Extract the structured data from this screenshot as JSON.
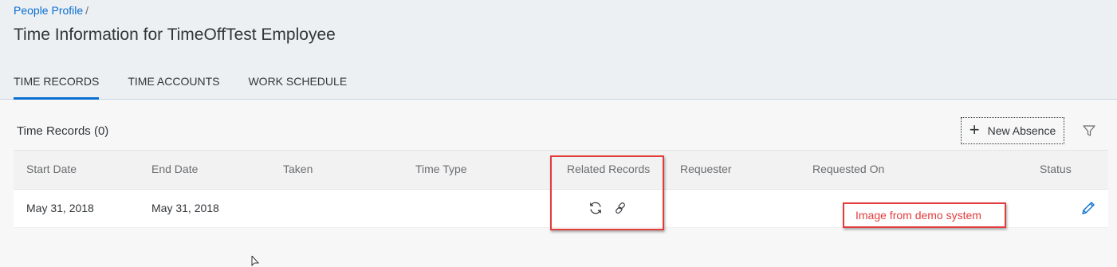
{
  "breadcrumb": {
    "link": "People Profile",
    "separator": "/"
  },
  "page_title": "Time Information for TimeOffTest Employee",
  "tabs": [
    {
      "label": "TIME RECORDS",
      "active": true
    },
    {
      "label": "TIME ACCOUNTS",
      "active": false
    },
    {
      "label": "WORK SCHEDULE",
      "active": false
    }
  ],
  "time_records": {
    "title": "Time Records (0)",
    "new_absence_label": "New Absence",
    "columns": {
      "start_date": "Start Date",
      "end_date": "End Date",
      "taken": "Taken",
      "time_type": "Time Type",
      "related_records": "Related Records",
      "requester": "Requester",
      "requested_on": "Requested On",
      "status": "Status"
    },
    "rows": [
      {
        "start_date": "May 31, 2018",
        "end_date": "May 31, 2018",
        "taken": "",
        "time_type": "",
        "requester": "",
        "requested_on": "",
        "related_record_icons": [
          "refresh-icon",
          "link-icon"
        ],
        "status_icon": "edit-pencil-icon"
      }
    ]
  },
  "annotation": {
    "text": "Image from demo system",
    "color": "#e23c3c"
  },
  "colors": {
    "accent": "#0a6ed1",
    "header_bg": "#edf0f3",
    "annotation_red": "#e23c3c"
  }
}
